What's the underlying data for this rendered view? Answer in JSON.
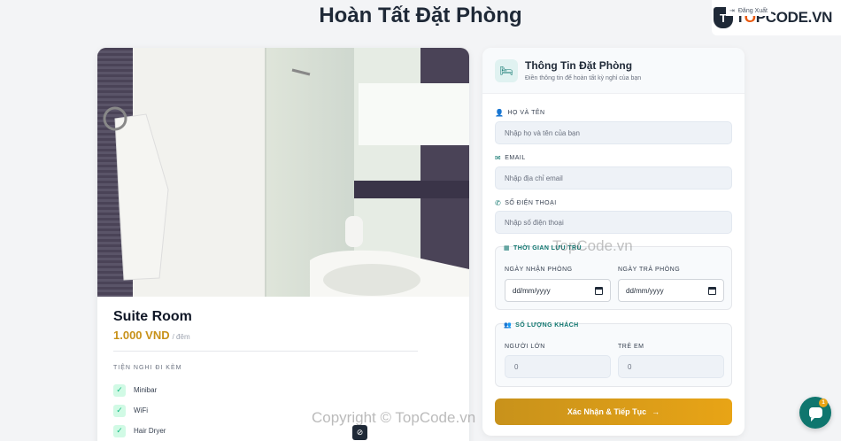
{
  "page": {
    "title": "Hoàn Tất Đặt Phòng"
  },
  "header": {
    "logout_label": "Đăng Xuất",
    "logo_text_pre": "T",
    "logo_text_accent": "O",
    "logo_text_post": "PCODE.VN",
    "logo_mark": "T"
  },
  "room": {
    "name": "Suite Room",
    "price": "1.000 VND",
    "unit": "/ đêm",
    "amenities_title": "TIỆN NGHI ĐI KÈM",
    "amenities": [
      "Minibar",
      "WiFi",
      "Hair Dryer"
    ]
  },
  "form": {
    "title": "Thông Tin Đặt Phòng",
    "subtitle": "Điền thông tin để hoàn tất kỳ nghỉ của bạn",
    "fullname": {
      "label": "HỌ VÀ TÊN",
      "placeholder": "Nhập họ và tên của bạn"
    },
    "email": {
      "label": "EMAIL",
      "placeholder": "Nhập địa chỉ email"
    },
    "phone": {
      "label": "SỐ ĐIỆN THOẠI",
      "placeholder": "Nhập số điện thoại"
    },
    "stay": {
      "title": "THỜI GIAN LƯU TRÚ",
      "checkin_label": "NGÀY NHẬN PHÒNG",
      "checkout_label": "NGÀY TRẢ PHÒNG",
      "checkin_value": "dd/mm/yyyy",
      "checkout_value": "dd/mm/yyyy"
    },
    "guests": {
      "title": "SỐ LƯỢNG KHÁCH",
      "adults_label": "NGƯỜI LỚN",
      "children_label": "TRẺ EM",
      "adults_value": "0",
      "children_value": "0"
    },
    "submit_label": "Xác Nhận & Tiếp Tục"
  },
  "watermarks": {
    "mid": "TopCode.vn",
    "bottom": "Copyright © TopCode.vn"
  },
  "chat": {
    "badge": "1"
  },
  "colors": {
    "accent": "#c8921b",
    "teal": "#0f766e"
  }
}
